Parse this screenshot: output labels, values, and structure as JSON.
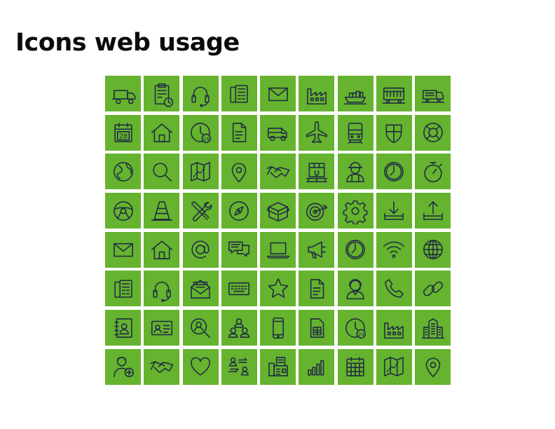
{
  "title": "Icons web usage",
  "colors": {
    "tile": "#65b32e",
    "stroke": "#1f2a44",
    "title": "#0b0b0b"
  },
  "icons": [
    "truck-icon",
    "clipboard-clock-icon",
    "headset-icon",
    "fax-icon",
    "envelope-icon",
    "factory-icon",
    "cargo-ship-icon",
    "train-icon",
    "locomotive-icon",
    "calendar-28-icon",
    "home-icon",
    "clock-24-icon",
    "document-icon",
    "van-icon",
    "airplane-icon",
    "tram-icon",
    "shield-icon",
    "lifebuoy-icon",
    "globe-earth-icon",
    "magnifier-icon",
    "map-route-icon",
    "location-pin-icon",
    "handshake-icon",
    "box-on-pallet-icon",
    "worker-icon",
    "clock-icon",
    "stopwatch-icon",
    "steering-wheel-icon",
    "traffic-cone-icon",
    "tools-icon",
    "compass-icon",
    "open-box-icon",
    "target-icon",
    "gear-icon",
    "download-tray-icon",
    "upload-tray-icon",
    "envelope-icon",
    "home-icon",
    "at-sign-icon",
    "chat-bubbles-icon",
    "laptop-icon",
    "megaphone-icon",
    "clock-icon",
    "wifi-icon",
    "globe-icon",
    "fax-icon",
    "headset-icon",
    "open-envelope-icon",
    "keyboard-icon",
    "star-icon",
    "document-icon",
    "operator-icon",
    "phone-handset-icon",
    "chain-link-icon",
    "address-book-icon",
    "id-card-icon",
    "search-user-icon",
    "team-icon",
    "smartphone-icon",
    "sim-card-icon",
    "clock-24-icon",
    "factory-icon",
    "skyscraper-icon",
    "add-user-icon",
    "handshake-icon",
    "heart-icon",
    "user-exchange-icon",
    "fax-machine-icon",
    "signal-bars-icon",
    "calendar-icon",
    "map-route-icon",
    "location-pin-icon"
  ]
}
